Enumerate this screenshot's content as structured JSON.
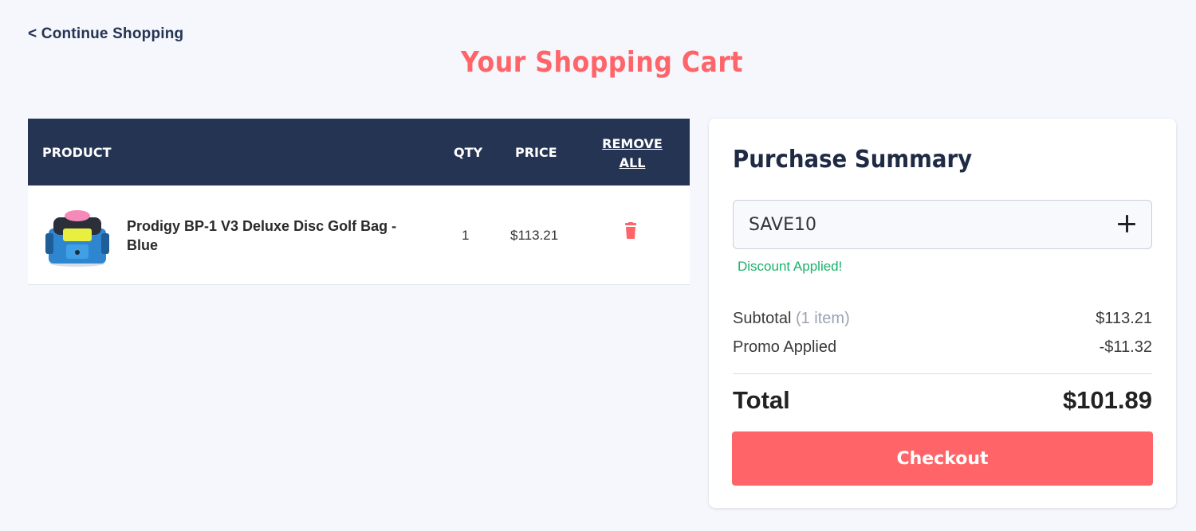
{
  "nav": {
    "continue_label": "< Continue Shopping"
  },
  "page": {
    "title": "Your Shopping Cart"
  },
  "cart": {
    "columns": {
      "product": "PRODUCT",
      "qty": "QTY",
      "price": "PRICE",
      "remove_all": "REMOVE ALL"
    },
    "items": [
      {
        "name": "Prodigy BP-1 V3 Deluxe Disc Golf Bag - Blue",
        "qty": "1",
        "price": "$113.21",
        "image_icon": "disc-golf-bag-blue",
        "remove_icon": "trash-icon"
      }
    ]
  },
  "summary": {
    "title": "Purchase Summary",
    "promo_value": "SAVE10",
    "promo_apply_icon": "plus-icon",
    "discount_message": "Discount Applied!",
    "subtotal_label": "Subtotal",
    "subtotal_count": "(1 item)",
    "subtotal_value": "$113.21",
    "promo_label": "Promo Applied",
    "promo_amount": "-$11.32",
    "total_label": "Total",
    "total_value": "$101.89",
    "checkout_label": "Checkout"
  },
  "colors": {
    "accent": "#ff6468",
    "header_bg": "#253453",
    "success": "#19b36b",
    "background": "#f5f7fd"
  }
}
